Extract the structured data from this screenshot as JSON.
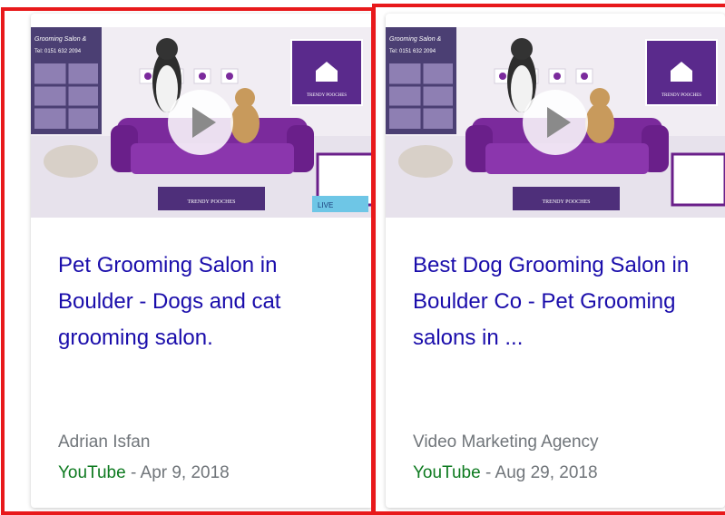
{
  "cards": [
    {
      "title": "Pet Grooming Salon in Boulder - Dogs and cat grooming salon.",
      "author": "Adrian Isfan",
      "source": "YouTube",
      "separator": " - ",
      "date": "Apr 9, 2018",
      "thumb": {
        "sign_line1": "Grooming Salon &",
        "sign_line2": "Tel: 0151 632 2094",
        "logo_text": "TRENDY POOCHES",
        "badge_text": "LIVE"
      }
    },
    {
      "title": "Best Dog Grooming Salon in Boulder Co - Pet Grooming salons in ...",
      "author": "Video Marketing Agency",
      "source": "YouTube",
      "separator": " - ",
      "date": "Aug 29, 2018",
      "thumb": {
        "sign_line1": "Grooming Salon &",
        "sign_line2": "Tel: 0151 632 2094",
        "logo_text": "TRENDY POOCHES"
      }
    }
  ],
  "colors": {
    "title_link": "#1a0dab",
    "source_green": "#0d7a1f",
    "meta_gray": "#70757a",
    "highlight_red": "#e8191b",
    "sofa_purple": "#7b2a9c"
  },
  "icons": [
    "play-icon",
    "brand-logo-icon"
  ]
}
